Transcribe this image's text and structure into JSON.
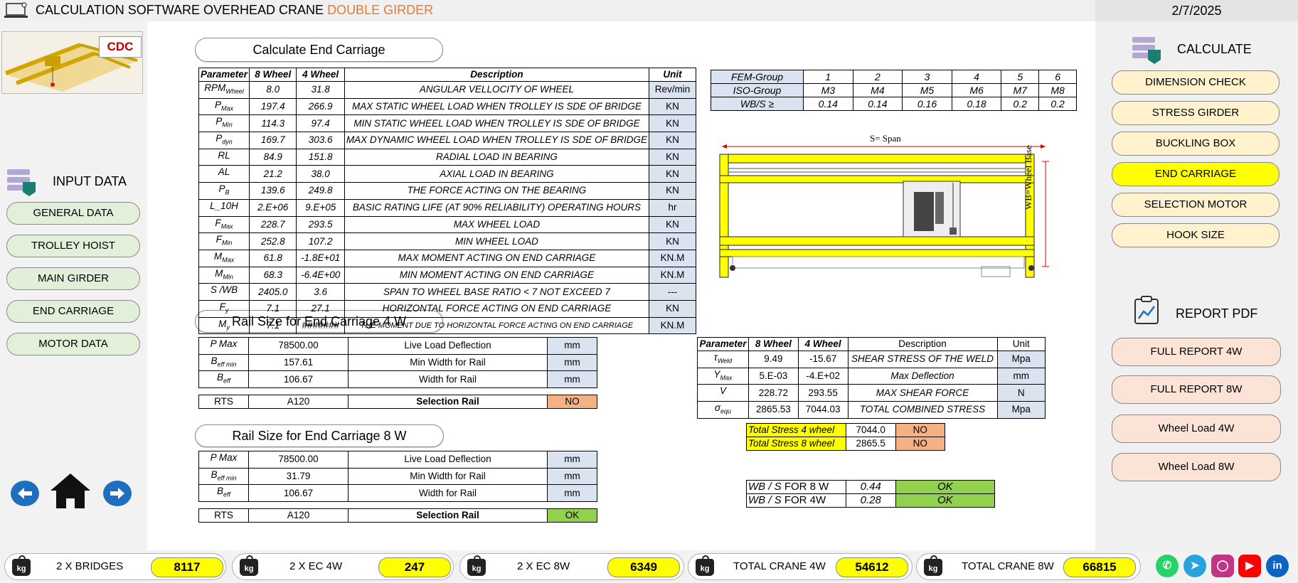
{
  "header": {
    "title_main": "CALCULATION SOFTWARE OVERHEAD CRANE ",
    "title_accent": "DOUBLE GIRDER",
    "date": "2/7/2025",
    "logo_text": "CDC"
  },
  "sidebar_left": {
    "section_title": "INPUT DATA",
    "items": [
      "GENERAL DATA",
      "TROLLEY HOIST",
      "MAIN GIRDER",
      "END CARRIAGE",
      "MOTOR DATA"
    ]
  },
  "sidebar_right": {
    "calc_title": "CALCULATE",
    "calc_items": [
      "DIMENSION CHECK",
      "STRESS GIRDER",
      "BUCKLING BOX",
      "END CARRIAGE",
      "SELECTION MOTOR",
      "HOOK SIZE"
    ],
    "report_title": "REPORT PDF",
    "report_items": [
      "FULL REPORT 4W",
      "FULL REPORT 8W",
      "Wheel Load 4W",
      "Wheel Load  8W"
    ]
  },
  "end_carriage": {
    "heading": "Calculate End Carriage",
    "headers": [
      "Parameter",
      "8 Wheel",
      "4 Wheel",
      "Description",
      "Unit"
    ],
    "rows": [
      {
        "p": "RPM",
        "s": "Wheel",
        "w8": "8.0",
        "w4": "31.8",
        "d": "ANGULAR VELLOCITY OF WHEEL",
        "u": "Rev/min"
      },
      {
        "p": "P",
        "s": "Max",
        "w8": "197.4",
        "w4": "266.9",
        "d": "MAX STATIC WHEEL LOAD WHEN TROLLEY IS SDE OF BRIDGE",
        "u": "KN"
      },
      {
        "p": "P",
        "s": "Min",
        "w8": "114.3",
        "w4": "97.4",
        "d": "MIN STATIC WHEEL LOAD WHEN TROLLEY IS SDE OF BRIDGE",
        "u": "KN"
      },
      {
        "p": "P",
        "s": "dyn",
        "w8": "169.7",
        "w4": "303.6",
        "d": "MAX DYNAMIC WHEEL LOAD WHEN TROLLEY IS SDE OF BRIDGE",
        "u": "KN"
      },
      {
        "p": "RL",
        "s": "",
        "w8": "84.9",
        "w4": "151.8",
        "d": "RADIAL LOAD IN BEARING",
        "u": "KN"
      },
      {
        "p": "AL",
        "s": "",
        "w8": "21.2",
        "w4": "38.0",
        "d": "AXIAL LOAD IN BEARING",
        "u": "KN"
      },
      {
        "p": "P",
        "s": "B",
        "w8": "139.6",
        "w4": "249.8",
        "d": "THE FORCE ACTING ON THE BEARING",
        "u": "KN"
      },
      {
        "p": "L_10H",
        "s": "",
        "w8": "2.E+06",
        "w4": "9.E+05",
        "d": "BASIC RATING LIFE (AT 90% RELIABILITY) OPERATING HOURS",
        "u": "hr"
      },
      {
        "p": "F",
        "s": "Max",
        "w8": "228.7",
        "w4": "293.5",
        "d": "MAX WHEEL LOAD",
        "u": "KN"
      },
      {
        "p": "F",
        "s": "Min",
        "w8": "252.8",
        "w4": "107.2",
        "d": "MIN WHEEL LOAD",
        "u": "KN"
      },
      {
        "p": "M",
        "s": "Max",
        "w8": "61.8",
        "w4": "-1.8E+01",
        "d": "MAX MOMENT ACTING ON END CARRIAGE",
        "u": "KN.M"
      },
      {
        "p": "M",
        "s": "Min",
        "w8": "68.3",
        "w4": "-6.4E+00",
        "d": "MIN MOMENT ACTING ON END CARRIAGE",
        "u": "KN.M"
      },
      {
        "p": "S /WB",
        "s": "",
        "w8": "2405.0",
        "w4": "3.6",
        "d": "SPAN TO WHEEL BASE RATIO < 7 NOT EXCEED 7",
        "u": "---"
      },
      {
        "p": "F",
        "s": "y",
        "w8": "7.1",
        "w4": "27.1",
        "d": "HORIZONTAL FORCE ACTING ON END CARRIAGE",
        "u": "KN"
      },
      {
        "p": "M",
        "s": "y",
        "w8": "7.1",
        "w4": "#######",
        "d": "THE MOMENT DUE TO HORIZONTAL FORCE ACTING ON END CARRIAGE",
        "u": "KN.M"
      }
    ]
  },
  "fem": {
    "row1": [
      "FEM-Group",
      "1",
      "2",
      "3",
      "4",
      "5",
      "6"
    ],
    "row2": [
      "ISO-Group",
      "M3",
      "M4",
      "M5",
      "M6",
      "M7",
      "M8"
    ],
    "row3": [
      "WB/S ≥",
      "0.14",
      "0.14",
      "0.16",
      "0.18",
      "0.2",
      "0.2"
    ]
  },
  "drawing": {
    "span_label": "S= Span",
    "wheelbase_label": "WB=Wheel Base"
  },
  "rail_4w": {
    "heading": "Rail Size for End Carriage 4 W",
    "rows": [
      {
        "p": "P Max",
        "s": "",
        "v": "78500.00",
        "d": "Live Load Deflection",
        "u": "mm"
      },
      {
        "p": "B",
        "s": "eff min",
        "v": "157.61",
        "d": "Min Width for Rail",
        "u": "mm"
      },
      {
        "p": "B",
        "s": "eff",
        "v": "106.67",
        "d": "Width for Rail",
        "u": "mm"
      }
    ],
    "rts": {
      "label": "RTS",
      "value": "A120",
      "desc": "Selection Rail",
      "status": "NO"
    }
  },
  "rail_8w": {
    "heading": "Rail Size for End Carriage  8 W",
    "rows": [
      {
        "p": "P Max",
        "s": "",
        "v": "78500.00",
        "d": "Live Load Deflection",
        "u": "mm"
      },
      {
        "p": "B",
        "s": "eff min",
        "v": "31.79",
        "d": "Min Width for Rail",
        "u": "mm"
      },
      {
        "p": "B",
        "s": "eff",
        "v": "106.67",
        "d": "Width for Rail",
        "u": "mm"
      }
    ],
    "rts": {
      "label": "RTS",
      "value": "A120",
      "desc": "Selection Rail",
      "status": "OK"
    }
  },
  "weld": {
    "headers": [
      "Parameter",
      "8 Wheel",
      "4 Wheel",
      "Description",
      "Unit"
    ],
    "rows": [
      {
        "p": "τ",
        "s": "Weld",
        "w8": "9.49",
        "w4": "-15.67",
        "d": "SHEAR STRESS  OF THE WELD",
        "u": "Mpa"
      },
      {
        "p": "Y",
        "s": "Max",
        "w8": "5.E-03",
        "w4": "-4.E+02",
        "d": "Max Deflection",
        "u": "mm"
      },
      {
        "p": "V",
        "s": "",
        "w8": "228.72",
        "w4": "293.55",
        "d": "MAX SHEAR FORCE",
        "u": "N"
      },
      {
        "p": "σ",
        "s": "equ",
        "w8": "2865.53",
        "w4": "7044.03",
        "d": "TOTAL COMBINED STRESS",
        "u": "Mpa"
      }
    ]
  },
  "total_stress": [
    {
      "label": "Total Stress 4 wheel",
      "value": "7044.0",
      "status": "NO"
    },
    {
      "label": "Total Stress 8 wheel",
      "value": "2865.5",
      "status": "NO"
    }
  ],
  "wbs": [
    {
      "label_a": "WB / S",
      "label_b": " FOR 8 W",
      "value": "0.44",
      "status": "OK"
    },
    {
      "label_a": "WB / S",
      "label_b": " FOR 4W",
      "value": "0.28",
      "status": "OK"
    }
  ],
  "footer": [
    {
      "label": "2 X BRIDGES",
      "value": "8117"
    },
    {
      "label": "2 X EC 4W",
      "value": "247"
    },
    {
      "label": "2 X EC 8W",
      "value": "6349"
    },
    {
      "label": "TOTAL CRANE 4W",
      "value": "54612"
    },
    {
      "label": "TOTAL CRANE 8W",
      "value": "66815"
    }
  ],
  "kg_label": "kg",
  "colors": {
    "accent": "#e07b39",
    "highlight": "#ffff00",
    "ok": "#92d050",
    "no": "#f4b183",
    "unit": "#dce3f0"
  }
}
